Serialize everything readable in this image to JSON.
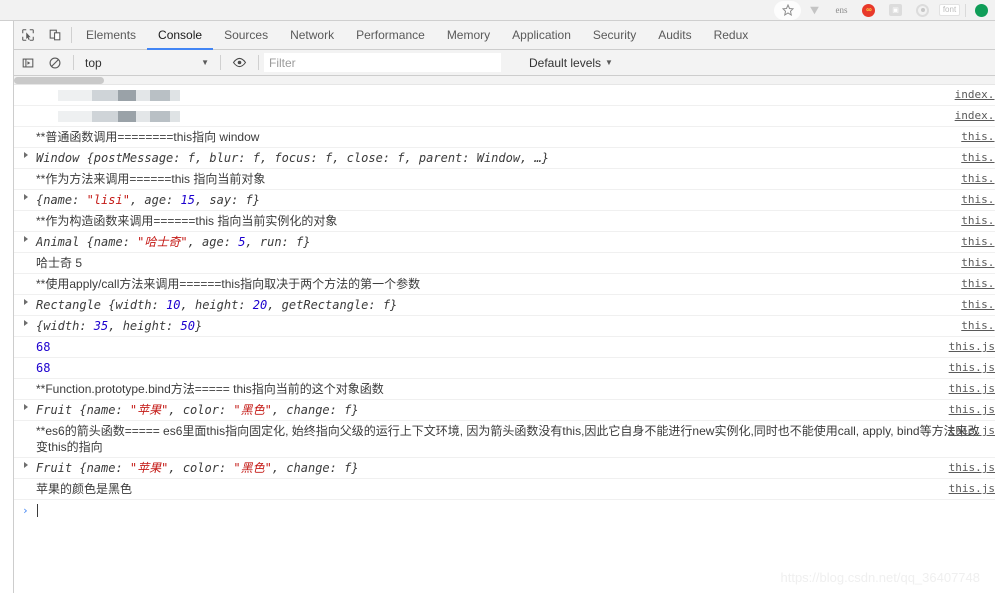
{
  "browser": {
    "icons": [
      {
        "name": "bookmark-star-icon",
        "glyph": "star"
      },
      {
        "name": "download-arrow-icon",
        "glyph": "arrow-down"
      },
      {
        "name": "extension-ens-icon",
        "label": "ens"
      },
      {
        "name": "extension-infinity-icon",
        "label": "oo"
      },
      {
        "name": "extension-box-icon",
        "label": ""
      },
      {
        "name": "extension-target-icon",
        "label": ""
      },
      {
        "name": "extension-font-icon",
        "label": "font"
      },
      {
        "name": "extension-green-icon",
        "label": ""
      }
    ]
  },
  "devtools": {
    "toolbar_icons": [
      {
        "name": "inspect-element-icon",
        "title": "Inspect"
      },
      {
        "name": "device-toolbar-icon",
        "title": "Toggle device toolbar"
      }
    ],
    "tabs": [
      {
        "label": "Elements",
        "active": false
      },
      {
        "label": "Console",
        "active": true
      },
      {
        "label": "Sources",
        "active": false
      },
      {
        "label": "Network",
        "active": false
      },
      {
        "label": "Performance",
        "active": false
      },
      {
        "label": "Memory",
        "active": false
      },
      {
        "label": "Application",
        "active": false
      },
      {
        "label": "Security",
        "active": false
      },
      {
        "label": "Audits",
        "active": false
      },
      {
        "label": "Redux",
        "active": false
      }
    ],
    "console_toolbar": {
      "sidebar_toggle_name": "console-sidebar-toggle-icon",
      "clear_console_name": "clear-console-icon",
      "context_selected": "top",
      "eye_icon_name": "live-expression-eye-icon",
      "filter_placeholder": "Filter",
      "filter_value": "",
      "levels_label": "Default levels"
    }
  },
  "console": {
    "messages": [
      {
        "type": "blurred",
        "text": "",
        "source": "index.j",
        "source_clipped": true,
        "expandable": false
      },
      {
        "type": "blurred",
        "text": "",
        "source": "index.j",
        "source_clipped": true,
        "expandable": false
      },
      {
        "type": "log",
        "text": "**普通函数调用========this指向 window",
        "source": "this.j",
        "source_clipped": true,
        "expandable": false
      },
      {
        "type": "object",
        "class_name": "Window",
        "text": "Window {postMessage: f, blur: f, focus: f, close: f, parent: Window, …}",
        "source": "this.j",
        "source_clipped": true,
        "expandable": true
      },
      {
        "type": "log",
        "text": "**作为方法来调用======this 指向当前对象",
        "source": "this.j",
        "source_clipped": true,
        "expandable": false
      },
      {
        "type": "object",
        "class_name": "",
        "text": "{name: \"lisi\", age: 15, say: f}",
        "source": "this.j",
        "source_clipped": true,
        "expandable": true
      },
      {
        "type": "log",
        "text": "**作为构造函数来调用======this 指向当前实例化的对象",
        "source": "this.j",
        "source_clipped": true,
        "expandable": false
      },
      {
        "type": "object",
        "class_name": "Animal",
        "text": "Animal {name: \"哈士奇\", age: 5, run: f}",
        "source": "this.j",
        "source_clipped": true,
        "expandable": true
      },
      {
        "type": "log",
        "text": "哈士奇 5",
        "source": "this.j",
        "source_clipped": true,
        "expandable": false
      },
      {
        "type": "log",
        "text": "**使用apply/call方法来调用======this指向取决于两个方法的第一个参数",
        "source": "this.j",
        "source_clipped": true,
        "expandable": false
      },
      {
        "type": "object",
        "class_name": "Rectangle",
        "text": "Rectangle {width: 10, height: 20, getRectangle: f}",
        "source": "this.j",
        "source_clipped": true,
        "expandable": true
      },
      {
        "type": "object",
        "class_name": "",
        "text": "{width: 35, height: 50}",
        "source": "this.j",
        "source_clipped": true,
        "expandable": true
      },
      {
        "type": "number",
        "text": "68",
        "source": "this.js",
        "source_clipped": false,
        "expandable": false
      },
      {
        "type": "number",
        "text": "68",
        "source": "this.js",
        "source_clipped": false,
        "expandable": false
      },
      {
        "type": "log",
        "text": "**Function.prototype.bind方法===== this指向当前的这个对象函数",
        "source": "this.js",
        "source_clipped": false,
        "expandable": false
      },
      {
        "type": "object",
        "class_name": "Fruit",
        "text": "Fruit {name: \"苹果\", color: \"黑色\", change: f}",
        "source": "this.js",
        "source_clipped": false,
        "expandable": true
      },
      {
        "type": "log",
        "text": "**es6的箭头函数===== es6里面this指向固定化, 始终指向父级的运行上下文环境, 因为箭头函数没有this,因此它自身不能进行new实例化,同时也不能使用call, apply, bind等方法来改变this的指向",
        "source": "this.js",
        "source_clipped": false,
        "expandable": false
      },
      {
        "type": "object",
        "class_name": "Fruit",
        "text": "Fruit {name: \"苹果\", color: \"黑色\", change: f}",
        "source": "this.js",
        "source_clipped": false,
        "expandable": true
      },
      {
        "type": "log",
        "text": "苹果的颜色是黑色",
        "source": "this.js",
        "source_clipped": false,
        "expandable": false
      }
    ],
    "prompt": {
      "chevron": "›",
      "value": ""
    }
  },
  "watermark": "https://blog.csdn.net/qq_36407748",
  "colors": {
    "active_tab_underline": "#4285f4",
    "string_literal": "#c41a16",
    "number_literal": "#1c00cf",
    "prompt_chevron": "#4285f4",
    "panel_bg": "#ffffff",
    "toolbar_bg": "#f3f3f3"
  }
}
